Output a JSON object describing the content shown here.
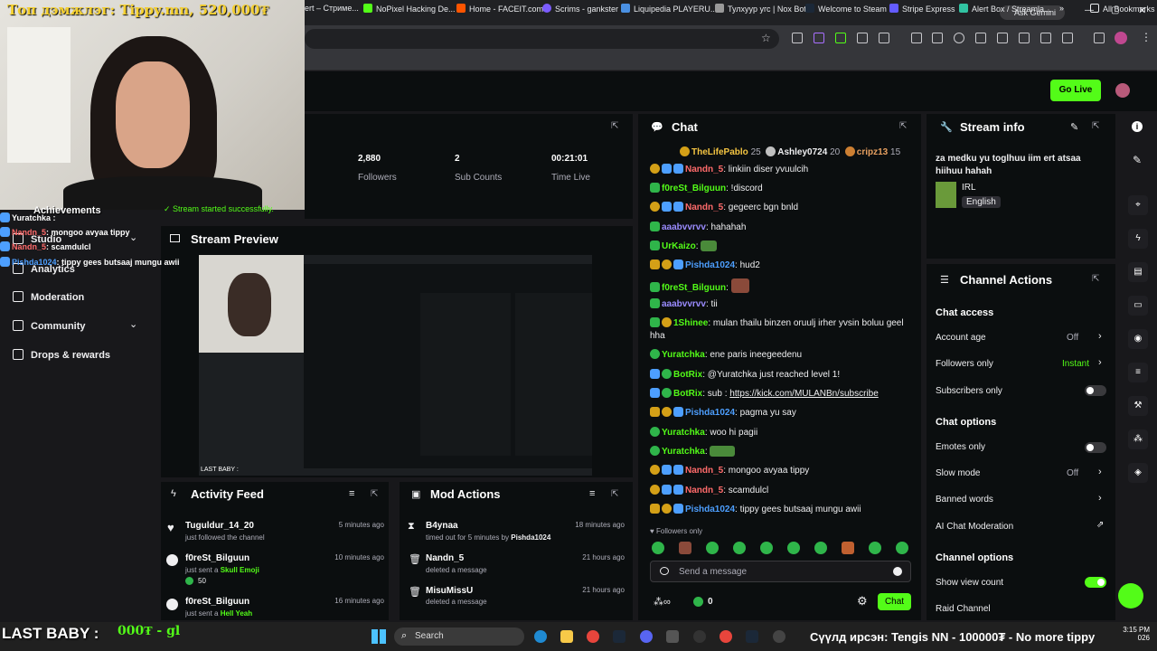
{
  "overlay": {
    "top_banner": "Топ дэмжлэг: Tippy.mn, 520,000₮",
    "achievements": "Achievements",
    "stream_started": "Stream started successfully.",
    "chat_lines": [
      {
        "user": "Yuratchka",
        "text": ":"
      },
      {
        "user": "Nandn_5",
        "text": ": mongoo avyaa tippy"
      },
      {
        "user": "Nandn_5",
        "text": ": scamdulcl"
      },
      {
        "user": "Pishda1024",
        "text": ": tippy gees butsaaj mungu awii"
      }
    ],
    "bottom_left": "LAST BABY :",
    "bottom_amount": "000₮ - gl",
    "ticker": "Сүүлд ирсэн: Tengis NN - 100000₮ - No more tippy"
  },
  "browser": {
    "ask_gemini": "Ask Gemini",
    "bookmarks": [
      "ert – Стриме...",
      "NoPixel Hacking De...",
      "Home - FACEIT.com",
      "Scrims - gankster",
      "Liquipedia PLAYERU...",
      "Тулхуур угс | Nox Bot",
      "Welcome to Steam",
      "Stripe Express",
      "Alert Box / Streamla...",
      "All Bookmarks"
    ]
  },
  "header": {
    "go_live": "Go Live"
  },
  "sidebar": {
    "items": [
      {
        "label": "Studio"
      },
      {
        "label": "Analytics"
      },
      {
        "label": "Moderation"
      },
      {
        "label": "Community"
      },
      {
        "label": "Drops & rewards"
      }
    ]
  },
  "stats": [
    {
      "value": "2,880",
      "label": "Followers"
    },
    {
      "value": "2",
      "label": "Sub Counts"
    },
    {
      "value": "00:21:01",
      "label": "Time Live"
    }
  ],
  "stream_preview": {
    "title": "Stream Preview",
    "caption": "LAST BABY :"
  },
  "chat": {
    "title": "Chat",
    "leaderboard": [
      {
        "name": "TheLifePablo",
        "count": "25"
      },
      {
        "name": "Ashley0724",
        "count": "20"
      },
      {
        "name": "cripz13",
        "count": "15"
      }
    ],
    "messages": [
      {
        "user": "Nandn_5",
        "color": "#ff6b6b",
        "text": ": linkiin diser yvuulcih"
      },
      {
        "user": "f0reSt_Bilguun",
        "color": "#53fc18",
        "text": ": !discord"
      },
      {
        "user": "Nandn_5",
        "color": "#ff6b6b",
        "text": ": gegeerc bgn bnld"
      },
      {
        "user": "aaabvvrvv",
        "color": "#9b8cff",
        "text": ": hahahah"
      },
      {
        "user": "UrKaizo",
        "color": "#53fc18",
        "text": ":"
      },
      {
        "user": "Pishda1024",
        "color": "#4d9fff",
        "text": ": hud2"
      },
      {
        "user": "f0reSt_Bilguun",
        "color": "#53fc18",
        "text": ":"
      },
      {
        "user": "aaabvvrvv",
        "color": "#9b8cff",
        "text": ": tii"
      },
      {
        "user": "1Shinee",
        "color": "#53fc18",
        "text": ": mulan thailu binzen oruulj irher yvsin boluu geel hha"
      },
      {
        "user": "Yuratchka",
        "color": "#53fc18",
        "text": ": ene paris ineegeedenu"
      },
      {
        "user": "BotRix",
        "color": "#53fc18",
        "text": ": @Yuratchka just reached level 1!"
      },
      {
        "user": "BotRix",
        "color": "#53fc18",
        "text": ": sub :",
        "link": "https://kick.com/MULANBn/subscribe"
      },
      {
        "user": "Pishda1024",
        "color": "#4d9fff",
        "text": ": pagma yu say"
      },
      {
        "user": "Yuratchka",
        "color": "#53fc18",
        "text": ": woo hi pagii"
      },
      {
        "user": "Yuratchka",
        "color": "#53fc18",
        "text": ":"
      },
      {
        "user": "Nandn_5",
        "color": "#ff6b6b",
        "text": ": mongoo avyaa tippy"
      },
      {
        "user": "Nandn_5",
        "color": "#ff6b6b",
        "text": ": scamdulcl"
      },
      {
        "user": "Pishda1024",
        "color": "#4d9fff",
        "text": ": tippy gees butsaaj mungu awii"
      }
    ],
    "followers_only": "Followers only",
    "placeholder": "Send a message",
    "points": "0",
    "chat_button": "Chat"
  },
  "stream_info": {
    "title": "Stream info",
    "stream_title": "za medku yu toglhuu iim ert atsaa hiihuu hahah",
    "category": "IRL",
    "language": "English"
  },
  "channel_actions": {
    "title": "Channel Actions",
    "chat_access": "Chat access",
    "account_age": "Account age",
    "account_age_val": "Off",
    "followers_only": "Followers only",
    "followers_only_val": "Instant",
    "subscribers_only": "Subscribers only",
    "chat_options": "Chat options",
    "emotes_only": "Emotes only",
    "slow_mode": "Slow mode",
    "slow_mode_val": "Off",
    "banned_words": "Banned words",
    "ai_moderation": "AI Chat Moderation",
    "channel_options": "Channel options",
    "show_view_count": "Show view count",
    "raid_channel": "Raid Channel"
  },
  "activity_feed": {
    "title": "Activity Feed",
    "items": [
      {
        "name": "Tuguldur_14_20",
        "sub": "just followed the channel",
        "time": "5 minutes ago"
      },
      {
        "name": "f0reSt_Bilguun",
        "sub": "just sent a",
        "highlight": "Skull Emoji",
        "points": "50",
        "time": "10 minutes ago"
      },
      {
        "name": "f0reSt_Bilguun",
        "sub": "just sent a",
        "highlight": "Hell Yeah",
        "time": "16 minutes ago"
      }
    ]
  },
  "mod_actions": {
    "title": "Mod Actions",
    "items": [
      {
        "name": "B4ynaa",
        "sub": "timed out for 5 minutes by",
        "by": "Pishda1024",
        "time": "18 minutes ago"
      },
      {
        "name": "Nandn_5",
        "sub": "deleted a message",
        "time": "21 hours ago"
      },
      {
        "name": "MisuMissU",
        "sub": "deleted a message",
        "time": "21 hours ago"
      }
    ]
  },
  "taskbar": {
    "search": "Search",
    "time": "3:15 PM",
    "date": "026"
  },
  "colors": {
    "accent": "#53fc18",
    "panel": "#0b0e0f",
    "bg": "#18181b"
  }
}
